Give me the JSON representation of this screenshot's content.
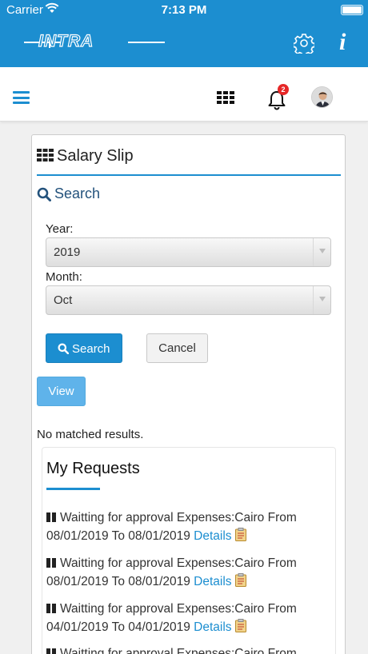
{
  "status_bar": {
    "carrier": "Carrier",
    "time": "7:13 PM"
  },
  "app_bar": {
    "logo_text": "INTRA",
    "info_label": "i"
  },
  "nav_bar": {
    "notification_count": "2"
  },
  "card": {
    "title": "Salary Slip",
    "search_heading": "Search",
    "year_label": "Year:",
    "year_value": "2019",
    "month_label": "Month:",
    "month_value": "Oct",
    "search_button": "Search",
    "cancel_button": "Cancel",
    "view_button": "View",
    "no_results": "No matched results."
  },
  "requests": {
    "title": "My Requests",
    "details_label": "Details",
    "items": [
      {
        "text": "Waitting for approval Expenses:Cairo From 08/01/2019 To 08/01/2019"
      },
      {
        "text": "Waitting for approval Expenses:Cairo From 08/01/2019 To 08/01/2019"
      },
      {
        "text": "Waitting for approval Expenses:Cairo From 04/01/2019 To 04/01/2019"
      },
      {
        "text": "Waitting for approval Expenses:Cairo From"
      }
    ]
  },
  "colors": {
    "brand": "#1c8ed0",
    "badge": "#e62727",
    "view_button": "#5fb3ea"
  }
}
